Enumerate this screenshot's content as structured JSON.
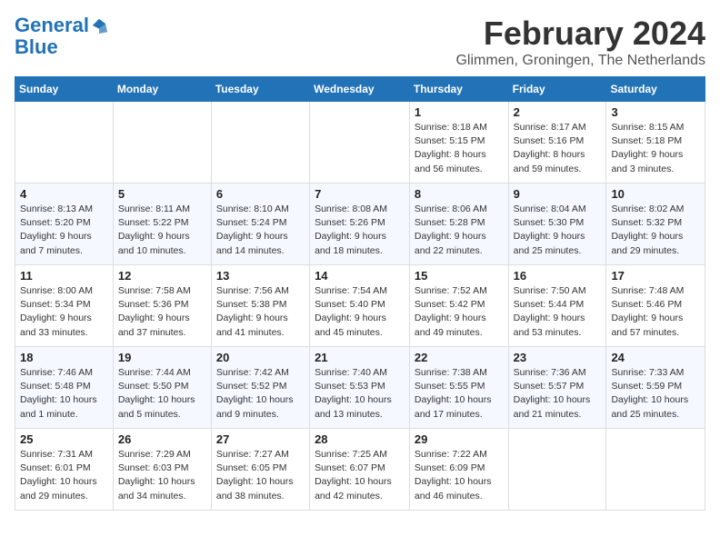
{
  "header": {
    "logo_line1": "General",
    "logo_line2": "Blue",
    "month_title": "February 2024",
    "location": "Glimmen, Groningen, The Netherlands"
  },
  "weekdays": [
    "Sunday",
    "Monday",
    "Tuesday",
    "Wednesday",
    "Thursday",
    "Friday",
    "Saturday"
  ],
  "weeks": [
    [
      {
        "day": "",
        "info": ""
      },
      {
        "day": "",
        "info": ""
      },
      {
        "day": "",
        "info": ""
      },
      {
        "day": "",
        "info": ""
      },
      {
        "day": "1",
        "info": "Sunrise: 8:18 AM\nSunset: 5:15 PM\nDaylight: 8 hours\nand 56 minutes."
      },
      {
        "day": "2",
        "info": "Sunrise: 8:17 AM\nSunset: 5:16 PM\nDaylight: 8 hours\nand 59 minutes."
      },
      {
        "day": "3",
        "info": "Sunrise: 8:15 AM\nSunset: 5:18 PM\nDaylight: 9 hours\nand 3 minutes."
      }
    ],
    [
      {
        "day": "4",
        "info": "Sunrise: 8:13 AM\nSunset: 5:20 PM\nDaylight: 9 hours\nand 7 minutes."
      },
      {
        "day": "5",
        "info": "Sunrise: 8:11 AM\nSunset: 5:22 PM\nDaylight: 9 hours\nand 10 minutes."
      },
      {
        "day": "6",
        "info": "Sunrise: 8:10 AM\nSunset: 5:24 PM\nDaylight: 9 hours\nand 14 minutes."
      },
      {
        "day": "7",
        "info": "Sunrise: 8:08 AM\nSunset: 5:26 PM\nDaylight: 9 hours\nand 18 minutes."
      },
      {
        "day": "8",
        "info": "Sunrise: 8:06 AM\nSunset: 5:28 PM\nDaylight: 9 hours\nand 22 minutes."
      },
      {
        "day": "9",
        "info": "Sunrise: 8:04 AM\nSunset: 5:30 PM\nDaylight: 9 hours\nand 25 minutes."
      },
      {
        "day": "10",
        "info": "Sunrise: 8:02 AM\nSunset: 5:32 PM\nDaylight: 9 hours\nand 29 minutes."
      }
    ],
    [
      {
        "day": "11",
        "info": "Sunrise: 8:00 AM\nSunset: 5:34 PM\nDaylight: 9 hours\nand 33 minutes."
      },
      {
        "day": "12",
        "info": "Sunrise: 7:58 AM\nSunset: 5:36 PM\nDaylight: 9 hours\nand 37 minutes."
      },
      {
        "day": "13",
        "info": "Sunrise: 7:56 AM\nSunset: 5:38 PM\nDaylight: 9 hours\nand 41 minutes."
      },
      {
        "day": "14",
        "info": "Sunrise: 7:54 AM\nSunset: 5:40 PM\nDaylight: 9 hours\nand 45 minutes."
      },
      {
        "day": "15",
        "info": "Sunrise: 7:52 AM\nSunset: 5:42 PM\nDaylight: 9 hours\nand 49 minutes."
      },
      {
        "day": "16",
        "info": "Sunrise: 7:50 AM\nSunset: 5:44 PM\nDaylight: 9 hours\nand 53 minutes."
      },
      {
        "day": "17",
        "info": "Sunrise: 7:48 AM\nSunset: 5:46 PM\nDaylight: 9 hours\nand 57 minutes."
      }
    ],
    [
      {
        "day": "18",
        "info": "Sunrise: 7:46 AM\nSunset: 5:48 PM\nDaylight: 10 hours\nand 1 minute."
      },
      {
        "day": "19",
        "info": "Sunrise: 7:44 AM\nSunset: 5:50 PM\nDaylight: 10 hours\nand 5 minutes."
      },
      {
        "day": "20",
        "info": "Sunrise: 7:42 AM\nSunset: 5:52 PM\nDaylight: 10 hours\nand 9 minutes."
      },
      {
        "day": "21",
        "info": "Sunrise: 7:40 AM\nSunset: 5:53 PM\nDaylight: 10 hours\nand 13 minutes."
      },
      {
        "day": "22",
        "info": "Sunrise: 7:38 AM\nSunset: 5:55 PM\nDaylight: 10 hours\nand 17 minutes."
      },
      {
        "day": "23",
        "info": "Sunrise: 7:36 AM\nSunset: 5:57 PM\nDaylight: 10 hours\nand 21 minutes."
      },
      {
        "day": "24",
        "info": "Sunrise: 7:33 AM\nSunset: 5:59 PM\nDaylight: 10 hours\nand 25 minutes."
      }
    ],
    [
      {
        "day": "25",
        "info": "Sunrise: 7:31 AM\nSunset: 6:01 PM\nDaylight: 10 hours\nand 29 minutes."
      },
      {
        "day": "26",
        "info": "Sunrise: 7:29 AM\nSunset: 6:03 PM\nDaylight: 10 hours\nand 34 minutes."
      },
      {
        "day": "27",
        "info": "Sunrise: 7:27 AM\nSunset: 6:05 PM\nDaylight: 10 hours\nand 38 minutes."
      },
      {
        "day": "28",
        "info": "Sunrise: 7:25 AM\nSunset: 6:07 PM\nDaylight: 10 hours\nand 42 minutes."
      },
      {
        "day": "29",
        "info": "Sunrise: 7:22 AM\nSunset: 6:09 PM\nDaylight: 10 hours\nand 46 minutes."
      },
      {
        "day": "",
        "info": ""
      },
      {
        "day": "",
        "info": ""
      }
    ]
  ]
}
